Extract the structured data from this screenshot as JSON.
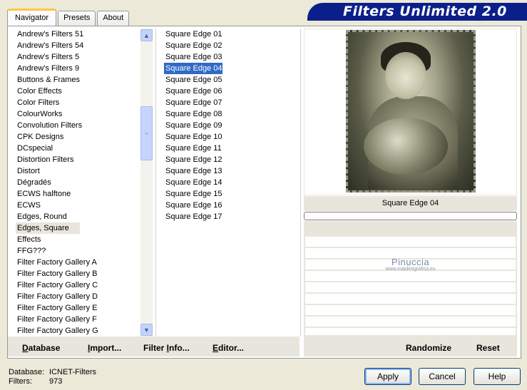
{
  "tabs": [
    {
      "label": "Navigator",
      "active": true
    },
    {
      "label": "Presets",
      "active": false
    },
    {
      "label": "About",
      "active": false
    }
  ],
  "banner": {
    "title": "Filters Unlimited 2.0"
  },
  "categories": [
    "Andrew's Filters 51",
    "Andrew's Filters 54",
    "Andrew's Filters 5",
    "Andrew's Filters 9",
    "Buttons & Frames",
    "Color Effects",
    "Color Filters",
    "ColourWorks",
    "Convolution Filters",
    "CPK Designs",
    "DCspecial",
    "Distortion Filters",
    "Distort",
    "Dégradés",
    "ECWS halftone",
    "ECWS",
    "Edges, Round",
    "Edges, Square",
    "Effects",
    "FFG???",
    "Filter Factory Gallery A",
    "Filter Factory Gallery B",
    "Filter Factory Gallery C",
    "Filter Factory Gallery D",
    "Filter Factory Gallery E",
    "Filter Factory Gallery F",
    "Filter Factory Gallery G"
  ],
  "selected_category": "Edges, Square",
  "filters": [
    "Square Edge 01",
    "Square Edge 02",
    "Square Edge 03",
    "Square Edge 04",
    "Square Edge 05",
    "Square Edge 06",
    "Square Edge 07",
    "Square Edge 08",
    "Square Edge 09",
    "Square Edge 10",
    "Square Edge 11",
    "Square Edge 12",
    "Square Edge 13",
    "Square Edge 14",
    "Square Edge 15",
    "Square Edge 16",
    "Square Edge 17"
  ],
  "selected_filter": "Square Edge 04",
  "preview": {
    "label": "Square Edge 04",
    "watermark_title": "Pinuccia",
    "watermark_sub": "www.maidiregrafica.eu"
  },
  "toolbar": {
    "database": {
      "pre": "",
      "u": "D",
      "post": "atabase"
    },
    "import": {
      "pre": "",
      "u": "I",
      "post": "mport..."
    },
    "filter_info": {
      "pre": "Filter ",
      "u": "I",
      "post": "nfo..."
    },
    "editor": {
      "pre": "",
      "u": "E",
      "post": "ditor..."
    },
    "randomize": "Randomize",
    "reset": "Reset"
  },
  "footer": {
    "database_label": "Database:",
    "database_value": "ICNET-Filters",
    "filters_label": "Filters:",
    "filters_value": "973"
  },
  "buttons": {
    "apply": "Apply",
    "cancel": "Cancel",
    "help": "Help"
  },
  "colors": {
    "banner": "#0b1f8a",
    "selection": "#316ac5",
    "active_tab_accent": "#ffc83c"
  }
}
